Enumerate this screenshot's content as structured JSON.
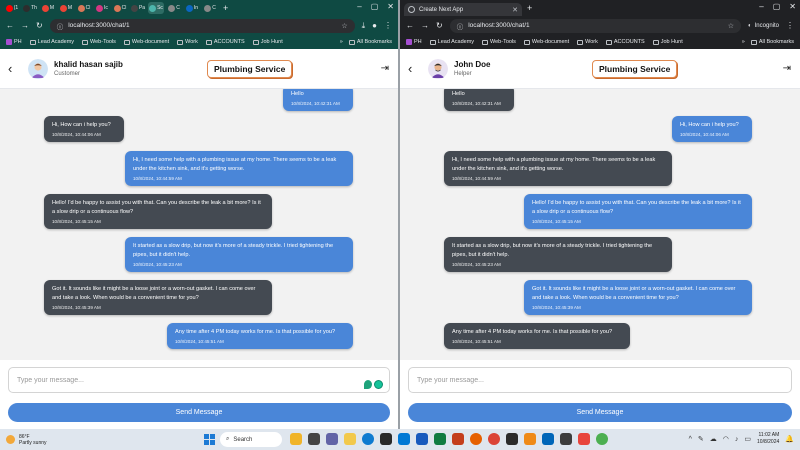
{
  "browser": {
    "left_tabs": [
      "(1",
      "Th",
      "M",
      "M",
      "Cl",
      "Ic",
      "Cl",
      "Pa",
      "Sc",
      "C",
      "In",
      "C"
    ],
    "right_tab_title": "Create Next App",
    "url": "localhost:3000/chat/1",
    "incognito_label": "Incognito",
    "bookmarks": [
      "PH",
      "Lead Academy",
      "Web-Tools",
      "Web-document",
      "Work",
      "ACCOUNTS",
      "Job Hunt"
    ],
    "all_bookmarks": "All Bookmarks"
  },
  "app": {
    "service_title": "Plumbing Service",
    "placeholder": "Type your message...",
    "send_label": "Send Message"
  },
  "left_pane": {
    "user_name": "khalid hasan sajib",
    "user_role": "Customer",
    "messages": [
      {
        "side": "out",
        "text": "Hello",
        "time": "10/8/2024, 10:42:31 AM"
      },
      {
        "side": "in",
        "text": "Hi, How can i help you?",
        "time": "10/8/2024, 10:44:06 AM"
      },
      {
        "side": "out",
        "text": "Hi, I need some help with a plumbing issue at my home. There seems to be a leak under the kitchen sink, and it's getting worse.",
        "time": "10/8/2024, 10:44:59 AM"
      },
      {
        "side": "in",
        "text": "Hello! I'd be happy to assist you with that. Can you describe the leak a bit more? Is it a slow drip or a continuous flow?",
        "time": "10/8/2024, 10:45:15 AM"
      },
      {
        "side": "out",
        "text": "It started as a slow drip, but now it's more of a steady trickle. I tried tightening the pipes, but it didn't help.",
        "time": "10/8/2024, 10:45:23 AM"
      },
      {
        "side": "in",
        "text": "Got it. It sounds like it might be a loose joint or a worn-out gasket. I can come over and take a look. When would be a convenient time for you?",
        "time": "10/8/2024, 10:45:39 AM"
      },
      {
        "side": "out",
        "text": "Any time after 4 PM today works for me. Is that possible for you?",
        "time": "10/8/2024, 10:45:51 AM"
      }
    ]
  },
  "right_pane": {
    "user_name": "John Doe",
    "user_role": "Helper",
    "messages": [
      {
        "side": "in",
        "text": "Hello",
        "time": "10/8/2024, 10:42:31 AM"
      },
      {
        "side": "out",
        "text": "Hi, How can i help you?",
        "time": "10/8/2024, 10:44:06 AM"
      },
      {
        "side": "in",
        "text": "Hi, I need some help with a plumbing issue at my home. There seems to be a leak under the kitchen sink, and it's getting worse.",
        "time": "10/8/2024, 10:44:59 AM"
      },
      {
        "side": "out",
        "text": "Hello! I'd be happy to assist you with that. Can you describe the leak a bit more? Is it a slow drip or a continuous flow?",
        "time": "10/8/2024, 10:45:15 AM"
      },
      {
        "side": "in",
        "text": "It started as a slow drip, but now it's more of a steady trickle. I tried tightening the pipes, but it didn't help.",
        "time": "10/8/2024, 10:45:23 AM"
      },
      {
        "side": "out",
        "text": "Got it. It sounds like it might be a loose joint or a worn-out gasket. I can come over and take a look. When would be a convenient time for you?",
        "time": "10/8/2024, 10:45:39 AM"
      },
      {
        "side": "in",
        "text": "Any time after 4 PM today works for me. Is that possible for you?",
        "time": "10/8/2024, 10:45:51 AM"
      }
    ]
  },
  "taskbar": {
    "weather_temp": "86°F",
    "weather_desc": "Partly sunny",
    "search_placeholder": "Search",
    "time": "11:02 AM",
    "date": "10/8/2024"
  },
  "colors": {
    "incoming_bubble": "#444a52",
    "outgoing_bubble": "#4a86d8",
    "send_button": "#4a86d8",
    "left_chrome": "#0f4a43",
    "right_chrome": "#202124"
  }
}
